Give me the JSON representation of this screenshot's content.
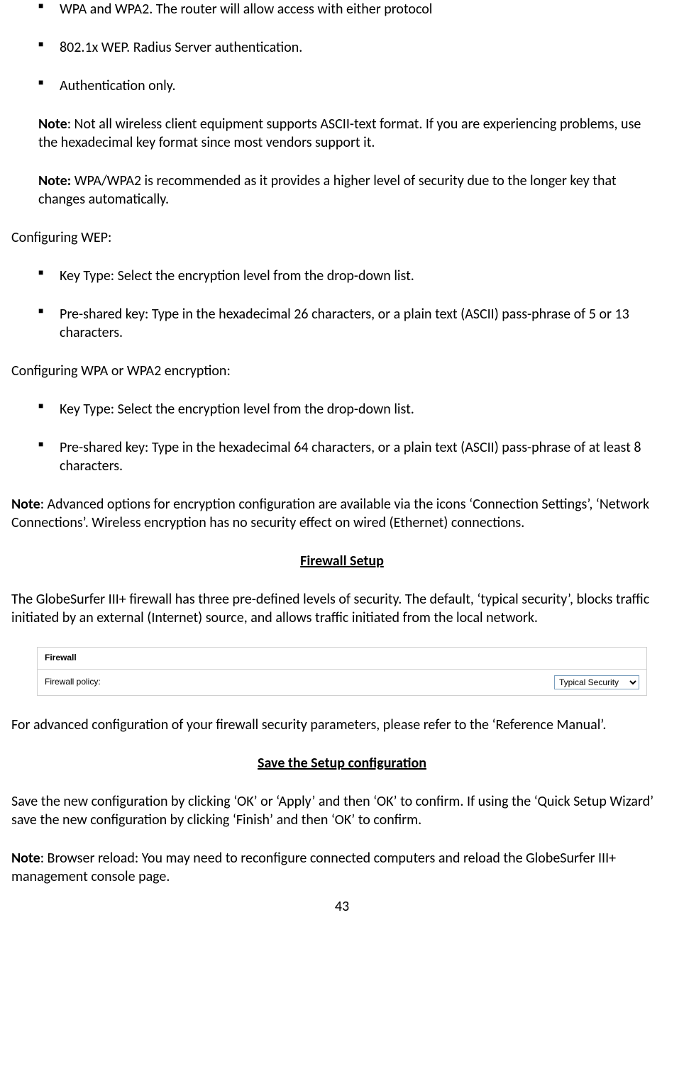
{
  "topBullets": [
    "WPA and WPA2. The router will allow access with either protocol",
    "802.1x WEP. Radius Server authentication.",
    "Authentication only."
  ],
  "note1": {
    "label": "Note",
    "text": ": Not all wireless client equipment supports ASCII-text format. If you are experiencing problems, use the hexadecimal key format since most vendors support it."
  },
  "note2": {
    "label": "Note:",
    "text": " WPA/WPA2 is recommended as it provides a higher level of security due to the longer key that changes automatically."
  },
  "wepHeading": "Configuring WEP:",
  "wepBullets": [
    "Key Type: Select the encryption level from the drop-down list.",
    "Pre-shared key: Type in the hexadecimal 26 characters, or a plain text (ASCII) pass-phrase of 5 or 13 characters."
  ],
  "wpaHeading": "Configuring WPA or WPA2 encryption:",
  "wpaBullets": [
    "Key Type: Select the encryption level from the drop-down list.",
    "Pre-shared key: Type in the hexadecimal 64 characters, or a plain text (ASCII) pass-phrase of at least 8 characters."
  ],
  "note3": {
    "label": "Note",
    "text": ": Advanced options for encryption configuration are available via the icons ‘Connection Settings’, ‘Network Connections’. Wireless encryption has no security effect on wired (Ethernet) connections."
  },
  "firewallSetup": {
    "heading": "Firewall Setup",
    "para": "The GlobeSurfer III+ firewall has three pre-defined levels of security. The default, ‘typical security’, blocks traffic initiated by an external (Internet) source, and allows traffic initiated from the local network.",
    "boxTitle": "Firewall",
    "boxLabel": "Firewall policy:",
    "boxSelectValue": "Typical Security",
    "afterPara": "For advanced configuration of your firewall security parameters, please refer to the ‘Reference Manual’."
  },
  "saveSetup": {
    "heading": "Save the Setup configuration",
    "para": "Save the new configuration by clicking ‘OK’ or ‘Apply’ and then ‘OK’ to confirm. If using the ‘Quick Setup Wizard’ save the new configuration by clicking ‘Finish’ and then ‘OK’ to confirm."
  },
  "note4": {
    "label": "Note",
    "text": ": Browser reload: You may need to reconfigure connected computers and reload the GlobeSurfer III+ management console page."
  },
  "pageNumber": "43"
}
